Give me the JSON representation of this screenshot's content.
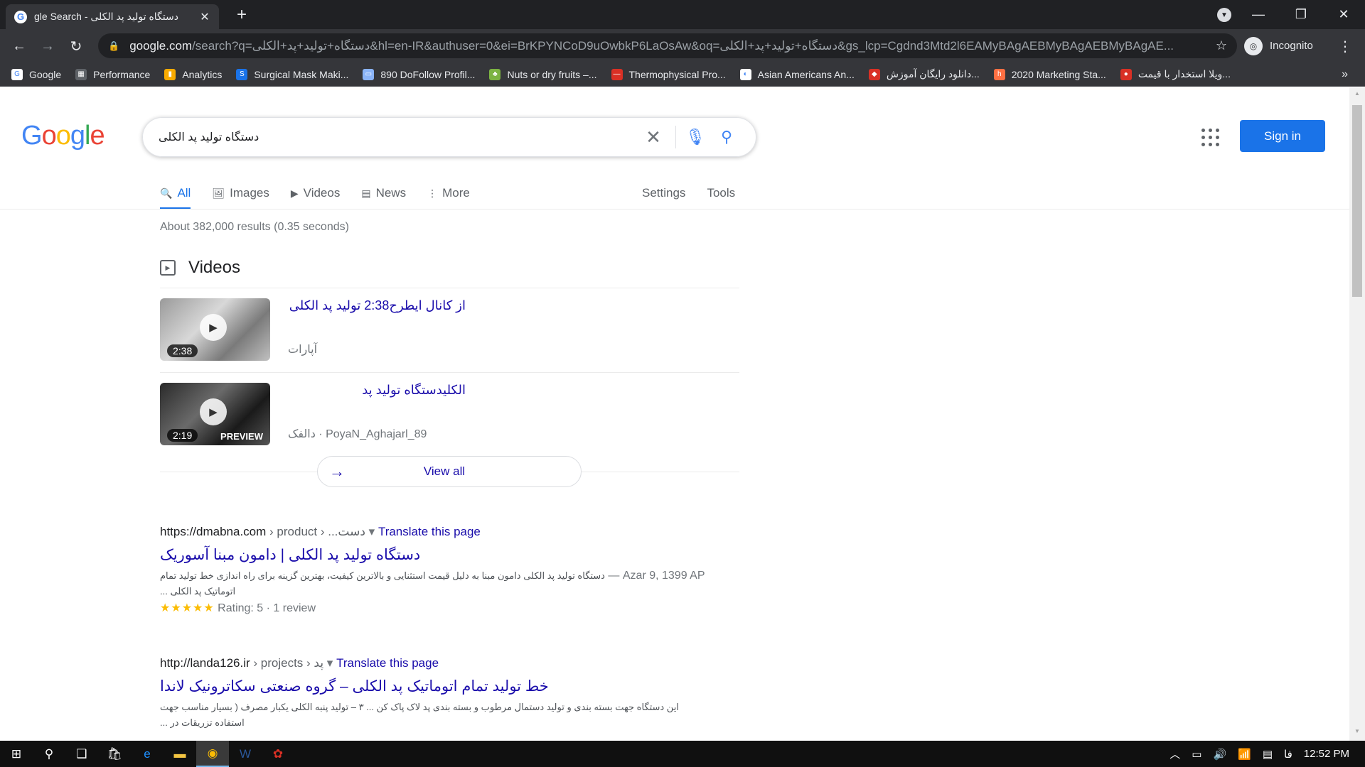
{
  "browser": {
    "tab_title": "gle Search - دستگاه تولید پد الکلی",
    "tab_close": "✕",
    "new_tab": "+",
    "url_host": "google.com",
    "url_rest": "/search?q=دستگاه+تولید+پد+الکلی&hl=en-IR&authuser=0&ei=BrKPYNCoD9uOwbkP6LaOsAw&oq=دستگاه+تولید+پد+الکلی&gs_lcp=Cgdnd3Mtd2l6EAMyBAgAEBMyBAgAEBMyBAgAE...",
    "incognito_label": "Incognito",
    "bookmarks": [
      {
        "label": "Google",
        "color": "#ffffff",
        "glyph": "G"
      },
      {
        "label": "Performance",
        "color": "#5f6368",
        "glyph": "▦"
      },
      {
        "label": "Analytics",
        "color": "#f9ab00",
        "glyph": "▮"
      },
      {
        "label": "Surgical Mask Maki...",
        "color": "#1a73e8",
        "glyph": "S"
      },
      {
        "label": "890 DoFollow Profil...",
        "color": "#8ab4f8",
        "glyph": "▭"
      },
      {
        "label": "Nuts or dry fruits –...",
        "color": "#7cb342",
        "glyph": "♣"
      },
      {
        "label": "Thermophysical Pro...",
        "color": "#d93025",
        "glyph": "—"
      },
      {
        "label": "Asian Americans An...",
        "color": "#ffffff",
        "glyph": "◐"
      },
      {
        "label": "دانلود رایگان آموزش...",
        "color": "#d93025",
        "glyph": "◆"
      },
      {
        "label": "2020 Marketing Sta...",
        "color": "#ff7043",
        "glyph": "h"
      },
      {
        "label": "ویلا استخدار با قیمت...",
        "color": "#d93025",
        "glyph": "●"
      }
    ],
    "bookmarks_more": "»"
  },
  "google": {
    "logo": "Google",
    "query": "دستگاه تولید پد الکلی",
    "signin_label": "Sign in",
    "tabs": [
      {
        "label": "All",
        "icon": "search-icon",
        "glyph": "🔍",
        "active": true
      },
      {
        "label": "Images",
        "icon": "image-icon",
        "glyph": "🖼",
        "active": false
      },
      {
        "label": "Videos",
        "icon": "video-icon",
        "glyph": "▶",
        "active": false
      },
      {
        "label": "News",
        "icon": "news-icon",
        "glyph": "▤",
        "active": false
      },
      {
        "label": "More",
        "icon": "more-icon",
        "glyph": "⋮",
        "active": false
      }
    ],
    "settings_label": "Settings",
    "tools_label": "Tools",
    "stats": "About 382,000 results (0.35 seconds)",
    "videos_heading": "Videos",
    "videos": [
      {
        "title": "از کانال ایطرح2:38 تولید پد الکلی",
        "source": "آپارات",
        "duration": "2:38",
        "preview": ""
      },
      {
        "title": "الکلیدستگاه تولید پد",
        "source": "دالفک · PoyaN_Aghajarl_89",
        "duration": "2:19",
        "preview": "PREVIEW"
      }
    ],
    "view_all_label": "View all",
    "results": [
      {
        "url": "https://dmabna.com",
        "path": " › product › ...دست",
        "translate": "Translate this page",
        "title": "دستگاه تولید پد الکلی | دامون مبنا آسوریک",
        "date": "Azar 9, 1399 AP — ",
        "snippet": "دستگاه تولید پد الکلی دامون مبنا به دلیل قیمت استثنایی و بالاترین کیفیت، بهترین گزینه برای راه اندازی خط تولید تمام اتوماتیک پد الکلی ...",
        "stars": "★★★★★",
        "rating": " Rating: 5 · 1 review"
      },
      {
        "url": "http://landa126.ir",
        "path": " › projects › پد",
        "translate": "Translate this page",
        "title": "خط تولید تمام اتوماتیک پد الکلی – گروه صنعتی سکاترونیک لاندا",
        "date": "",
        "snippet": "این دستگاه جهت بسته بندی و تولید دستمال مرطوب و بسته بندی پد لاک پاک کن ... ۳ – تولید پنبه الکلی یکبار مصرف ( بسیار مناسب جهت استفاده تزریقات در ...",
        "stars": "",
        "rating": ""
      }
    ]
  },
  "taskbar": {
    "lang": "فا",
    "time": "12:52 PM"
  }
}
